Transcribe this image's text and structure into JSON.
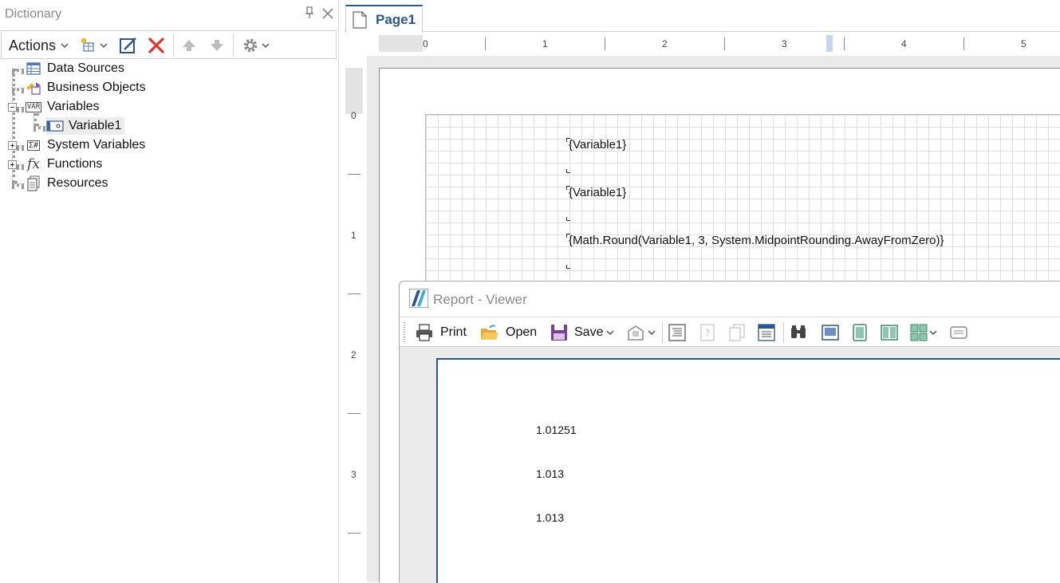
{
  "dictionary": {
    "title": "Dictionary",
    "actions_label": "Actions",
    "tree": {
      "data_sources": "Data Sources",
      "business_objects": "Business Objects",
      "variables": "Variables",
      "variable1": "Variable1",
      "system_variables": "System Variables",
      "functions": "Functions",
      "resources": "Resources"
    },
    "icons": {
      "variables": "VAR",
      "system_variables": "Σ#",
      "functions": "fx"
    }
  },
  "designer": {
    "tab_label": "Page1",
    "hruler_labels": [
      "0",
      "1",
      "2",
      "3",
      "4",
      "5"
    ],
    "vruler_labels": [
      "0",
      "1",
      "2",
      "3"
    ],
    "components": [
      "{Variable1}",
      "{Variable1}",
      "{Math.Round(Variable1, 3, System.MidpointRounding.AwayFromZero)}"
    ]
  },
  "viewer": {
    "title": "Report - Viewer",
    "print_label": "Print",
    "open_label": "Open",
    "save_label": "Save",
    "values": [
      "1.01251",
      "1.013",
      "1.013"
    ]
  },
  "colors": {
    "accent": "#2d5592",
    "delete": "#e0342b"
  }
}
